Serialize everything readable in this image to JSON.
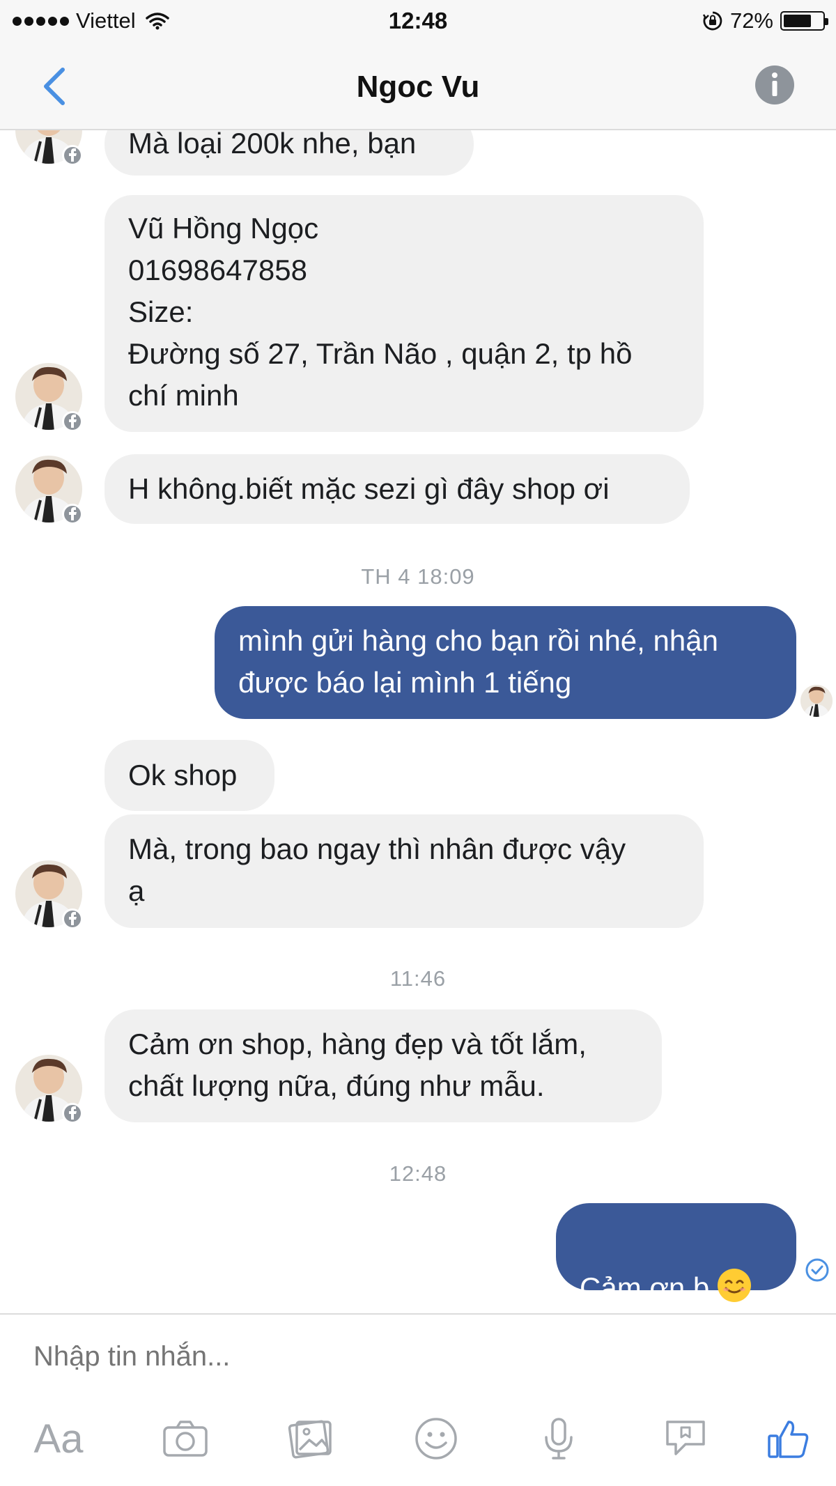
{
  "status_bar": {
    "carrier": "Viettel",
    "time": "12:48",
    "battery_percent": "72%",
    "battery_level": 0.72
  },
  "nav": {
    "title": "Ngoc Vu"
  },
  "messages": {
    "m1": "Mà loại 200k nhe, bạn",
    "m2": "Vũ Hồng Ngọc\n01698647858\nSize:\nĐường số 27, Trần Não , quận 2, tp hồ\nchí minh",
    "m3": "H không.biết mặc sezi gì đây shop ơi",
    "ts1": "TH 4 18:09",
    "m4": "mình gửi hàng cho bạn rồi nhé, nhận\nđược báo lại mình 1 tiếng",
    "m5": "Ok shop",
    "m6": "Mà, trong bao ngay thì nhân được vậy\nạ",
    "ts2": "11:46",
    "m7": "Cảm ơn shop, hàng đẹp và tốt lắm,\nchất lượng nữa, đúng như mẫu.",
    "ts3": "12:48",
    "m8": "Cảm ơn b"
  },
  "composer": {
    "placeholder": "Nhập tin nhắn...",
    "aa_label": "Aa"
  },
  "colors": {
    "outgoing_bubble": "#3b5998",
    "incoming_bubble": "#f0f0f0",
    "accent": "#4a90e2",
    "like": "#3b7de0"
  },
  "icons": {
    "back": "chevron-left-icon",
    "info": "info-icon",
    "camera": "camera-icon",
    "gallery": "gallery-icon",
    "emoji": "smiley-icon",
    "mic": "microphone-icon",
    "sticker": "sticker-icon",
    "like": "thumbs-up-icon",
    "read_receipt": "check-circle-icon"
  }
}
